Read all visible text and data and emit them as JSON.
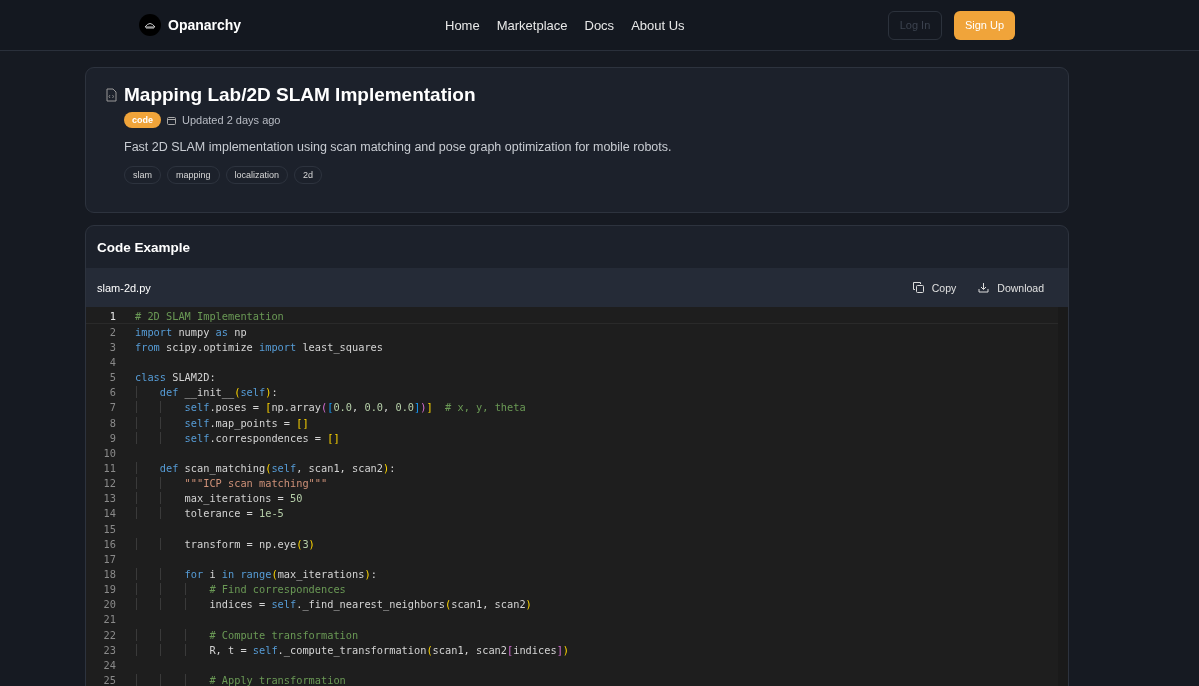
{
  "nav": {
    "brand": "Opanarchy",
    "links": [
      {
        "label": "Home"
      },
      {
        "label": "Marketplace"
      },
      {
        "label": "Docs"
      },
      {
        "label": "About Us"
      }
    ],
    "login": {
      "label": "Log In",
      "disabled": true
    },
    "signup": {
      "label": "Sign Up"
    }
  },
  "project": {
    "title": "Mapping Lab/2D SLAM Implementation",
    "badge": "code",
    "updated": "Updated 2 days ago",
    "description": "Fast 2D SLAM implementation using scan matching and pose graph optimization for mobile robots.",
    "tags": [
      "slam",
      "mapping",
      "localization",
      "2d"
    ]
  },
  "code_example": {
    "heading": "Code Example",
    "filename": "slam-2d.py",
    "copy": "Copy",
    "download": "Download",
    "lines": [
      {
        "number": "1",
        "current": true,
        "tokens": [
          {
            "kind": "comment",
            "t": "# 2D SLAM Implementation"
          }
        ]
      },
      {
        "number": "2",
        "current": false,
        "tokens": [
          {
            "kind": "kw",
            "t": "import"
          },
          {
            "kind": "plain",
            "t": " numpy "
          },
          {
            "kind": "kw",
            "t": "as"
          },
          {
            "kind": "plain",
            "t": " np"
          }
        ]
      },
      {
        "number": "3",
        "current": false,
        "tokens": [
          {
            "kind": "kw",
            "t": "from"
          },
          {
            "kind": "plain",
            "t": " scipy.optimize "
          },
          {
            "kind": "kw",
            "t": "import"
          },
          {
            "kind": "plain",
            "t": " least_squares"
          }
        ]
      },
      {
        "number": "4",
        "current": false
      },
      {
        "number": "5",
        "current": false,
        "tokens": [
          {
            "kind": "kw",
            "t": "class"
          },
          {
            "kind": "plain",
            "t": " SLAM2D:"
          }
        ]
      },
      {
        "number": "6",
        "current": false,
        "tokens": [
          {
            "kind": "kw",
            "t": "    def"
          },
          {
            "kind": "plain",
            "t": " __init__"
          },
          {
            "kind": "b1",
            "t": "("
          },
          {
            "kind": "kw",
            "t": "self"
          },
          {
            "kind": "b1",
            "t": ")"
          },
          {
            "kind": "plain",
            "t": ":"
          }
        ]
      },
      {
        "number": "7",
        "current": false,
        "tokens": [
          {
            "kind": "kw",
            "t": "        self"
          },
          {
            "kind": "plain",
            "t": ".poses = "
          },
          {
            "kind": "b1",
            "t": "["
          },
          {
            "kind": "plain",
            "t": "np.array"
          },
          {
            "kind": "b2",
            "t": "("
          },
          {
            "kind": "b3",
            "t": "["
          },
          {
            "kind": "num",
            "t": "0.0"
          },
          {
            "kind": "plain",
            "t": ", "
          },
          {
            "kind": "num",
            "t": "0.0"
          },
          {
            "kind": "plain",
            "t": ", "
          },
          {
            "kind": "num",
            "t": "0.0"
          },
          {
            "kind": "b3",
            "t": "]"
          },
          {
            "kind": "b2",
            "t": ")"
          },
          {
            "kind": "b1",
            "t": "]"
          },
          {
            "kind": "comment",
            "t": "  # x, y, theta"
          }
        ]
      },
      {
        "number": "8",
        "current": false,
        "tokens": [
          {
            "kind": "kw",
            "t": "        self"
          },
          {
            "kind": "plain",
            "t": ".map_points = "
          },
          {
            "kind": "b1",
            "t": "[]"
          }
        ]
      },
      {
        "number": "9",
        "current": false,
        "tokens": [
          {
            "kind": "kw",
            "t": "        self"
          },
          {
            "kind": "plain",
            "t": ".correspondences = "
          },
          {
            "kind": "b1",
            "t": "[]"
          }
        ]
      },
      {
        "number": "10",
        "current": false
      },
      {
        "number": "11",
        "current": false,
        "tokens": [
          {
            "kind": "kw",
            "t": "    def"
          },
          {
            "kind": "plain",
            "t": " scan_matching"
          },
          {
            "kind": "b1",
            "t": "("
          },
          {
            "kind": "kw",
            "t": "self"
          },
          {
            "kind": "plain",
            "t": ", scan1, scan2"
          },
          {
            "kind": "b1",
            "t": ")"
          },
          {
            "kind": "plain",
            "t": ":"
          }
        ]
      },
      {
        "number": "12",
        "current": false,
        "tokens": [
          {
            "kind": "str",
            "t": "        \"\"\"ICP scan matching\"\"\""
          }
        ]
      },
      {
        "number": "13",
        "current": false,
        "tokens": [
          {
            "kind": "plain",
            "t": "        max_iterations = "
          },
          {
            "kind": "num",
            "t": "50"
          }
        ]
      },
      {
        "number": "14",
        "current": false,
        "tokens": [
          {
            "kind": "plain",
            "t": "        tolerance = "
          },
          {
            "kind": "num",
            "t": "1e-5"
          }
        ]
      },
      {
        "number": "15",
        "current": false
      },
      {
        "number": "16",
        "current": false,
        "tokens": [
          {
            "kind": "plain",
            "t": "        transform = np.eye"
          },
          {
            "kind": "b1",
            "t": "("
          },
          {
            "kind": "num",
            "t": "3"
          },
          {
            "kind": "b1",
            "t": ")"
          }
        ]
      },
      {
        "number": "17",
        "current": false
      },
      {
        "number": "18",
        "current": false,
        "tokens": [
          {
            "kind": "kw",
            "t": "        for"
          },
          {
            "kind": "plain",
            "t": " i "
          },
          {
            "kind": "kw",
            "t": "in range"
          },
          {
            "kind": "b1",
            "t": "("
          },
          {
            "kind": "plain",
            "t": "max_iterations"
          },
          {
            "kind": "b1",
            "t": ")"
          },
          {
            "kind": "plain",
            "t": ":"
          }
        ]
      },
      {
        "number": "19",
        "current": false,
        "tokens": [
          {
            "kind": "comment",
            "t": "            # Find correspondences"
          }
        ]
      },
      {
        "number": "20",
        "current": false,
        "tokens": [
          {
            "kind": "plain",
            "t": "            indices = "
          },
          {
            "kind": "kw",
            "t": "self"
          },
          {
            "kind": "plain",
            "t": "._find_nearest_neighbors"
          },
          {
            "kind": "b1",
            "t": "("
          },
          {
            "kind": "plain",
            "t": "scan1, scan2"
          },
          {
            "kind": "b1",
            "t": ")"
          }
        ]
      },
      {
        "number": "21",
        "current": false
      },
      {
        "number": "22",
        "current": false,
        "tokens": [
          {
            "kind": "comment",
            "t": "            # Compute transformation"
          }
        ]
      },
      {
        "number": "23",
        "current": false,
        "tokens": [
          {
            "kind": "plain",
            "t": "            R, t = "
          },
          {
            "kind": "kw",
            "t": "self"
          },
          {
            "kind": "plain",
            "t": "._compute_transformation"
          },
          {
            "kind": "b1",
            "t": "("
          },
          {
            "kind": "plain",
            "t": "scan1, scan2"
          },
          {
            "kind": "b2",
            "t": "["
          },
          {
            "kind": "plain",
            "t": "indices"
          },
          {
            "kind": "b2",
            "t": "]"
          },
          {
            "kind": "b1",
            "t": ")"
          }
        ]
      },
      {
        "number": "24",
        "current": false
      },
      {
        "number": "25",
        "current": false,
        "tokens": [
          {
            "kind": "comment",
            "t": "            # Apply transformation"
          }
        ]
      }
    ]
  }
}
